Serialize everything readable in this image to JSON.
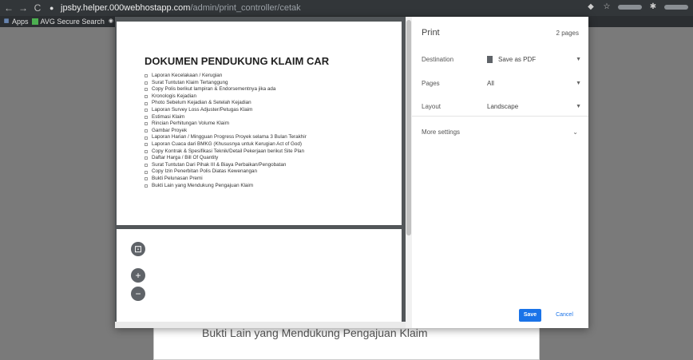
{
  "browser": {
    "url_host": "jpsby.helper.000webhostapp.com",
    "url_path": "/admin/print_controller/cetak",
    "bookmarks": [
      {
        "label": "Apps"
      },
      {
        "label": "AVG Secure Search"
      }
    ]
  },
  "background_page": {
    "line": "Bukti Lain yang Mendukung Pengajuan Klaim"
  },
  "preview": {
    "doc_title": "DOKUMEN PENDUKUNG KLAIM CAR",
    "items": [
      "Laporan Kecelakaan / Kerugian",
      "Surat Tuntutan Klaim Tertanggung",
      "Copy Polis berikut lampiran & Endorsementnya jika ada",
      "Kronologis Kejadian",
      "Photo Sebelum Kejadian & Setelah Kejadian",
      "Laporan Survey Loss Adjuster/Petugas Klaim",
      "Estimasi Klaim",
      "Rincian Perhitungan Volume Klaim",
      "Gambar Proyek",
      "Laporan Harian / Mingguan Progress Proyek selama 3 Bulan Terakhir",
      "Laporan Cuaca dari BMKG (Khususnya untuk Kerugian Act of God)",
      "Copy Kontrak & Spesifikasi Teknik/Detail Pekerjaan berikut Site Plan",
      "Daftar Harga / Bill Of Quantity",
      "Surat Tuntutan Dari Pihak III & Biaya Perbaikan/Pengobatan",
      "Copy Izin Penerbitan Polis Diatas Kewenangan",
      "Bukti Pelunasan Premi",
      "Bukti Lain yang Mendukung Pengajuan Klaim"
    ],
    "zoom_fit": "⊡",
    "zoom_in": "+",
    "zoom_out": "−"
  },
  "print_settings": {
    "title": "Print",
    "page_count": "2 pages",
    "destination_label": "Destination",
    "destination_value": "Save as PDF",
    "pages_label": "Pages",
    "pages_value": "All",
    "layout_label": "Layout",
    "layout_value": "Landscape",
    "more_settings": "More settings",
    "save_label": "Save",
    "cancel_label": "Cancel"
  },
  "colors": {
    "accent": "#1a73e8",
    "chrome_dark": "#323639",
    "backdrop": "#7a7a7a"
  }
}
